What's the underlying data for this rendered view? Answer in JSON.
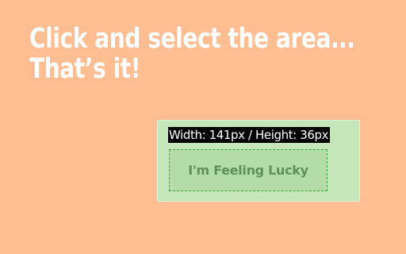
{
  "headline": {
    "line1": "Click and select the area...",
    "line2": "That’s it!"
  },
  "selection": {
    "dimension_label": "Width: 141px / Height: 36px",
    "button_label": "I'm Feeling Lucky"
  },
  "colors": {
    "background": "#FFBD92",
    "panel": "#C4E6B8",
    "selection_border": "#3fa63f",
    "readout_bg": "#000000"
  }
}
